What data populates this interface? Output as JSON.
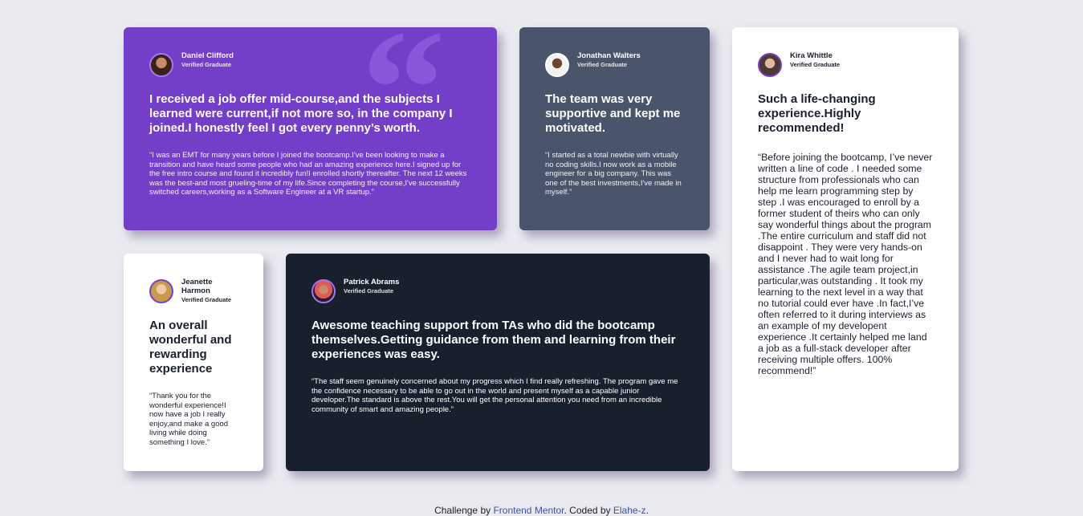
{
  "testimonials": [
    {
      "name": "Daniel Clifford",
      "role": "Verified Graduate",
      "headline": "I received a job offer mid-course,and the subjects I learned were current,if not more so, in the company I joined.I honestly feel I got every penny’s worth.",
      "body": "“I was an EMT for many years before I joined the bootcamp.I've been looking to make a transition and have heard some people who had an amazing experience here.I signed up for the free intro course and found it incredibly fun!I enrolled shortly thereafter. The next 12 weeks was the best-and most grueling-time of my life.Since completing the course,I've successfully switched careers,working as a Software Engineer at a VR startup.”",
      "background": "#733fc8"
    },
    {
      "name": "Jonathan Walters",
      "role": "Verified Graduate",
      "headline": "The team was very supportive and kept me motivated.",
      "body": "“I started as a total newbie with virtually no coding skills.I now work as a mobile engineer for a big company. This was one of the best investments,I've made in myself.”",
      "background": "#48556a"
    },
    {
      "name": "Kira Whittle",
      "role": "Verified Graduate",
      "headline": "Such a life-changing experience.Highly recommended!",
      "body": "“Before joining the bootcamp, I’ve never written a line of code . I needed some structure from professionals who can help me learn programming step by step .I was encouraged to enroll by a former student of theirs who can only say wonderful things about the program .The entire curriculum and staff did not disappoint . They were very hands-on and I never had to wait long for assistance .The agile team project,in particular,was outstanding . It took my learning to the next level in a way that no tutorial could ever have .In fact,I’ve often referred to it during interviews as an example of my developent experience .It certainly helped me land a job as a full-stack developer after receiving multiple offers. 100% recommend!”",
      "background": "#ffffff"
    },
    {
      "name": "Jeanette Harmon",
      "role": "Verified Graduate",
      "headline": "An overall wonderful and rewarding experience",
      "body": "“Thank you for the wonderful experience!I now have a job I really enjoy,and make a good living while doing something I love.”",
      "background": "#ffffff"
    },
    {
      "name": "Patrick Abrams",
      "role": "Verified Graduate",
      "headline": "Awesome teaching support from TAs who did the bootcamp themselves.Getting guidance from them and learning from their experiences was easy.",
      "body": "“The staff seem genuinely concerned about my progress which I find really refreshing. The program gave me the confidence necessary to be able to go out in the world and present myself as a capable junior developer.The standard is above the rest.You will get the personal attention you need from an incredible community of smart and amazing people.”",
      "background": "#19202d"
    }
  ],
  "decoration": {
    "quote_mark": "“",
    "quote_color": "#8d5cdd"
  },
  "footer": {
    "prefix": "Challenge by ",
    "link1": "Frontend Mentor",
    "middle": ". Coded by ",
    "link2": "Elahe-z",
    "suffix": ".",
    "link_color": "#3e52a3"
  }
}
